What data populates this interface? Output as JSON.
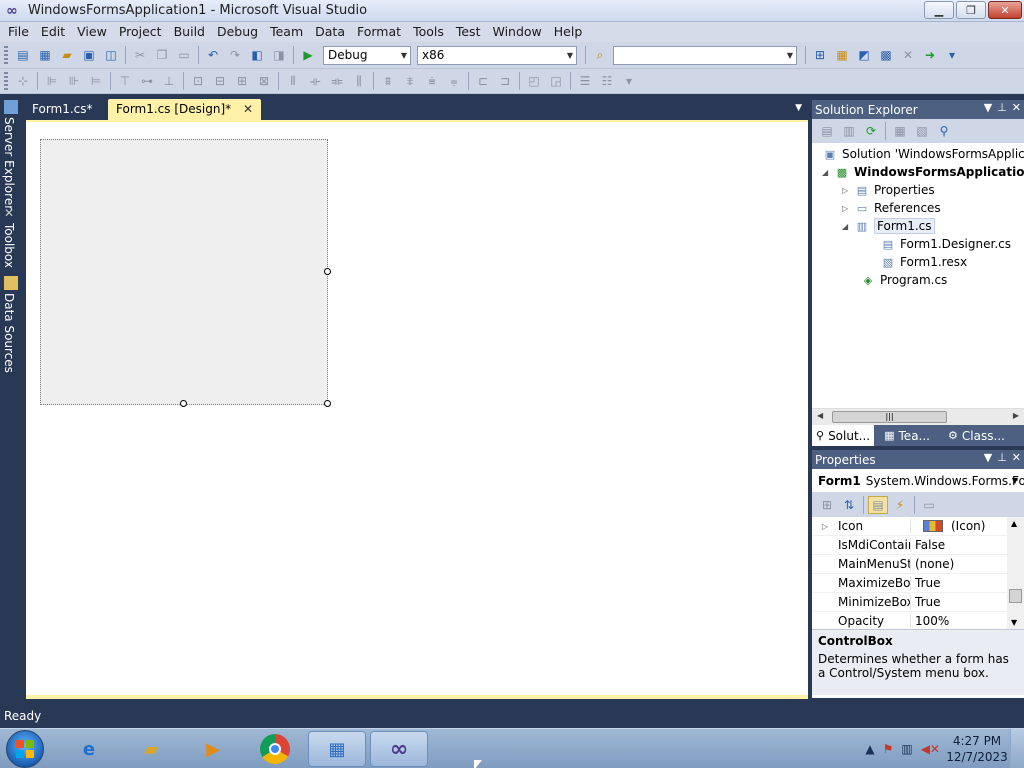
{
  "window": {
    "title": "WindowsFormsApplication1 - Microsoft Visual Studio"
  },
  "menu": [
    "File",
    "Edit",
    "View",
    "Project",
    "Build",
    "Debug",
    "Team",
    "Data",
    "Format",
    "Tools",
    "Test",
    "Window",
    "Help"
  ],
  "toolbar": {
    "config_value": "Debug",
    "platform_value": "x86",
    "find_value": ""
  },
  "side_tabs": [
    "Server Explorer",
    "Toolbox",
    "Data Sources"
  ],
  "doc_tabs": [
    {
      "label": "Form1.cs*",
      "active": false
    },
    {
      "label": "Form1.cs [Design]*",
      "active": true
    }
  ],
  "solution_explorer": {
    "title": "Solution Explorer",
    "nodes": [
      {
        "label": "Solution 'WindowsFormsApplica",
        "icon": "solution-icon"
      },
      {
        "label": "WindowsFormsApplication1",
        "icon": "csharp-project-icon",
        "bold": true
      },
      {
        "label": "Properties",
        "icon": "properties-folder-icon"
      },
      {
        "label": "References",
        "icon": "references-icon"
      },
      {
        "label": "Form1.cs",
        "icon": "form-icon",
        "selected": true
      },
      {
        "label": "Form1.Designer.cs",
        "icon": "code-file-icon"
      },
      {
        "label": "Form1.resx",
        "icon": "resx-file-icon"
      },
      {
        "label": "Program.cs",
        "icon": "csharp-file-icon"
      }
    ],
    "bottom_tabs": [
      "Solut...",
      "Tea...",
      "Class..."
    ]
  },
  "properties": {
    "title": "Properties",
    "object_name": "Form1",
    "object_type": "System.Windows.Forms.Fo",
    "rows": [
      {
        "name": "Icon",
        "value": "(Icon)"
      },
      {
        "name": "IsMdiContain",
        "value": "False"
      },
      {
        "name": "MainMenuStr",
        "value": "(none)"
      },
      {
        "name": "MaximizeBox",
        "value": "True"
      },
      {
        "name": "MinimizeBox",
        "value": "True"
      },
      {
        "name": "Opacity",
        "value": "100%"
      }
    ],
    "description_title": "ControlBox",
    "description_text": "Determines whether a form has a Control/System menu box."
  },
  "status": {
    "text": "Ready"
  },
  "taskbar": {
    "time": "4:27 PM",
    "date": "12/7/2023"
  }
}
